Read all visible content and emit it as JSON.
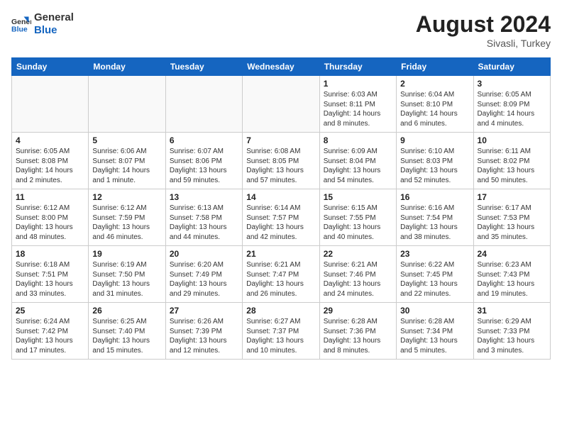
{
  "header": {
    "logo_line1": "General",
    "logo_line2": "Blue",
    "month_year": "August 2024",
    "location": "Sivasli, Turkey"
  },
  "days_of_week": [
    "Sunday",
    "Monday",
    "Tuesday",
    "Wednesday",
    "Thursday",
    "Friday",
    "Saturday"
  ],
  "weeks": [
    [
      {
        "day": "",
        "detail": ""
      },
      {
        "day": "",
        "detail": ""
      },
      {
        "day": "",
        "detail": ""
      },
      {
        "day": "",
        "detail": ""
      },
      {
        "day": "1",
        "detail": "Sunrise: 6:03 AM\nSunset: 8:11 PM\nDaylight: 14 hours\nand 8 minutes."
      },
      {
        "day": "2",
        "detail": "Sunrise: 6:04 AM\nSunset: 8:10 PM\nDaylight: 14 hours\nand 6 minutes."
      },
      {
        "day": "3",
        "detail": "Sunrise: 6:05 AM\nSunset: 8:09 PM\nDaylight: 14 hours\nand 4 minutes."
      }
    ],
    [
      {
        "day": "4",
        "detail": "Sunrise: 6:05 AM\nSunset: 8:08 PM\nDaylight: 14 hours\nand 2 minutes."
      },
      {
        "day": "5",
        "detail": "Sunrise: 6:06 AM\nSunset: 8:07 PM\nDaylight: 14 hours\nand 1 minute."
      },
      {
        "day": "6",
        "detail": "Sunrise: 6:07 AM\nSunset: 8:06 PM\nDaylight: 13 hours\nand 59 minutes."
      },
      {
        "day": "7",
        "detail": "Sunrise: 6:08 AM\nSunset: 8:05 PM\nDaylight: 13 hours\nand 57 minutes."
      },
      {
        "day": "8",
        "detail": "Sunrise: 6:09 AM\nSunset: 8:04 PM\nDaylight: 13 hours\nand 54 minutes."
      },
      {
        "day": "9",
        "detail": "Sunrise: 6:10 AM\nSunset: 8:03 PM\nDaylight: 13 hours\nand 52 minutes."
      },
      {
        "day": "10",
        "detail": "Sunrise: 6:11 AM\nSunset: 8:02 PM\nDaylight: 13 hours\nand 50 minutes."
      }
    ],
    [
      {
        "day": "11",
        "detail": "Sunrise: 6:12 AM\nSunset: 8:00 PM\nDaylight: 13 hours\nand 48 minutes."
      },
      {
        "day": "12",
        "detail": "Sunrise: 6:12 AM\nSunset: 7:59 PM\nDaylight: 13 hours\nand 46 minutes."
      },
      {
        "day": "13",
        "detail": "Sunrise: 6:13 AM\nSunset: 7:58 PM\nDaylight: 13 hours\nand 44 minutes."
      },
      {
        "day": "14",
        "detail": "Sunrise: 6:14 AM\nSunset: 7:57 PM\nDaylight: 13 hours\nand 42 minutes."
      },
      {
        "day": "15",
        "detail": "Sunrise: 6:15 AM\nSunset: 7:55 PM\nDaylight: 13 hours\nand 40 minutes."
      },
      {
        "day": "16",
        "detail": "Sunrise: 6:16 AM\nSunset: 7:54 PM\nDaylight: 13 hours\nand 38 minutes."
      },
      {
        "day": "17",
        "detail": "Sunrise: 6:17 AM\nSunset: 7:53 PM\nDaylight: 13 hours\nand 35 minutes."
      }
    ],
    [
      {
        "day": "18",
        "detail": "Sunrise: 6:18 AM\nSunset: 7:51 PM\nDaylight: 13 hours\nand 33 minutes."
      },
      {
        "day": "19",
        "detail": "Sunrise: 6:19 AM\nSunset: 7:50 PM\nDaylight: 13 hours\nand 31 minutes."
      },
      {
        "day": "20",
        "detail": "Sunrise: 6:20 AM\nSunset: 7:49 PM\nDaylight: 13 hours\nand 29 minutes."
      },
      {
        "day": "21",
        "detail": "Sunrise: 6:21 AM\nSunset: 7:47 PM\nDaylight: 13 hours\nand 26 minutes."
      },
      {
        "day": "22",
        "detail": "Sunrise: 6:21 AM\nSunset: 7:46 PM\nDaylight: 13 hours\nand 24 minutes."
      },
      {
        "day": "23",
        "detail": "Sunrise: 6:22 AM\nSunset: 7:45 PM\nDaylight: 13 hours\nand 22 minutes."
      },
      {
        "day": "24",
        "detail": "Sunrise: 6:23 AM\nSunset: 7:43 PM\nDaylight: 13 hours\nand 19 minutes."
      }
    ],
    [
      {
        "day": "25",
        "detail": "Sunrise: 6:24 AM\nSunset: 7:42 PM\nDaylight: 13 hours\nand 17 minutes."
      },
      {
        "day": "26",
        "detail": "Sunrise: 6:25 AM\nSunset: 7:40 PM\nDaylight: 13 hours\nand 15 minutes."
      },
      {
        "day": "27",
        "detail": "Sunrise: 6:26 AM\nSunset: 7:39 PM\nDaylight: 13 hours\nand 12 minutes."
      },
      {
        "day": "28",
        "detail": "Sunrise: 6:27 AM\nSunset: 7:37 PM\nDaylight: 13 hours\nand 10 minutes."
      },
      {
        "day": "29",
        "detail": "Sunrise: 6:28 AM\nSunset: 7:36 PM\nDaylight: 13 hours\nand 8 minutes."
      },
      {
        "day": "30",
        "detail": "Sunrise: 6:28 AM\nSunset: 7:34 PM\nDaylight: 13 hours\nand 5 minutes."
      },
      {
        "day": "31",
        "detail": "Sunrise: 6:29 AM\nSunset: 7:33 PM\nDaylight: 13 hours\nand 3 minutes."
      }
    ]
  ]
}
